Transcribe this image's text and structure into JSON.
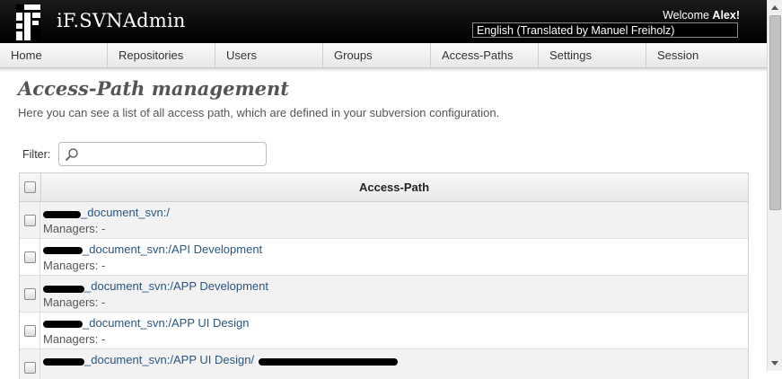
{
  "header": {
    "app_title": "iF.SVNAdmin",
    "welcome_prefix": "Welcome ",
    "user_name": "Alex!",
    "language": "English (Translated by Manuel Freiholz)"
  },
  "nav": {
    "items": [
      "Home",
      "Repositories",
      "Users",
      "Groups",
      "Access-Paths",
      "Settings",
      "Session"
    ]
  },
  "page": {
    "title": "Access-Path management",
    "description": "Here you can see a list of all access path, which are defined in your subversion configuration."
  },
  "filter": {
    "label": "Filter:",
    "value": "",
    "placeholder": ""
  },
  "table": {
    "header": "Access-Path",
    "rows": [
      {
        "path": "_document_svn:/",
        "managers": "Managers: -"
      },
      {
        "path": "_document_svn:/API Development",
        "managers": "Managers: -"
      },
      {
        "path": "_document_svn:/APP Development",
        "managers": "Managers: -"
      },
      {
        "path": "_document_svn:/APP UI Design",
        "managers": "Managers: -"
      },
      {
        "path": "_document_svn:/APP UI Design/",
        "managers": ""
      }
    ]
  },
  "icons": {
    "logo": "svnadmin-logo-icon",
    "search": "search-icon",
    "scroll_up": "scroll-up-icon",
    "scroll_down": "scroll-down-icon"
  },
  "colors": {
    "header_bg": "#000000",
    "link": "#2b5580",
    "title": "#555555"
  }
}
